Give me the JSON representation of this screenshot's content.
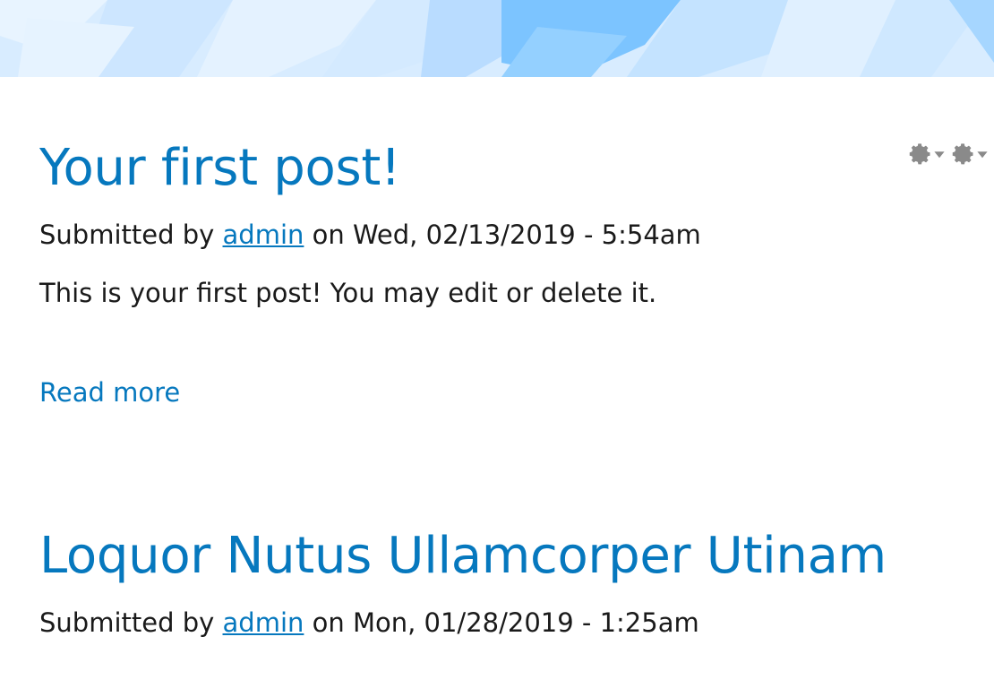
{
  "header": {
    "colors": {
      "base": "#dcefff",
      "accent": "#7cc4ff",
      "light": "#eef7ff"
    }
  },
  "contextual": {
    "triggers": [
      {
        "icon": "gear-icon"
      },
      {
        "icon": "gear-icon"
      }
    ]
  },
  "posts": [
    {
      "title": "Your first post!",
      "submitted_prefix": "Submitted by",
      "author": "admin",
      "date_text": "on Wed, 02/13/2019 - 5:54am",
      "body": "This is your first post! You may edit or delete it.",
      "read_more": "Read more"
    },
    {
      "title": "Loquor Nutus Ullamcorper Utinam",
      "submitted_prefix": "Submitted by",
      "author": "admin",
      "date_text": "on Mon, 01/28/2019 - 1:25am"
    }
  ],
  "colors": {
    "link": "#0678be",
    "text": "#1a1a1a",
    "icon": "#888888"
  }
}
